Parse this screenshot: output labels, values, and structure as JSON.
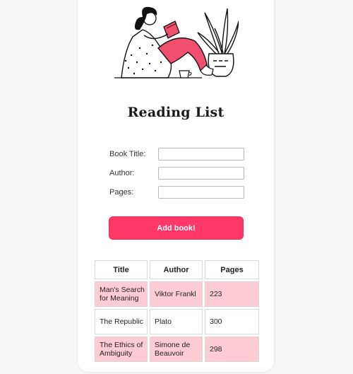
{
  "app": {
    "title": "Reading List"
  },
  "form": {
    "fields": [
      {
        "label": "Book Title:",
        "value": "",
        "placeholder": ""
      },
      {
        "label": "Author:",
        "value": "",
        "placeholder": ""
      },
      {
        "label": "Pages:",
        "value": "",
        "placeholder": ""
      }
    ],
    "submit_label": "Add book!"
  },
  "table": {
    "headers": [
      "Title",
      "Author",
      "Pages"
    ],
    "rows": [
      {
        "title": "Man's Search for Meaning",
        "author": "Viktor Frankl",
        "pages": "223",
        "highlight": true
      },
      {
        "title": "The Republic",
        "author": "Plato",
        "pages": "300",
        "highlight": false
      },
      {
        "title": "The Ethics of Ambiguity",
        "author": "Simone de Beauvoir",
        "pages": "298",
        "highlight": true
      }
    ]
  },
  "colors": {
    "accent": "#ff3868",
    "row_highlight": "#ffccd5",
    "legging": "#f0506e"
  },
  "illustration": {
    "icon": "woman-reading-illustration"
  }
}
